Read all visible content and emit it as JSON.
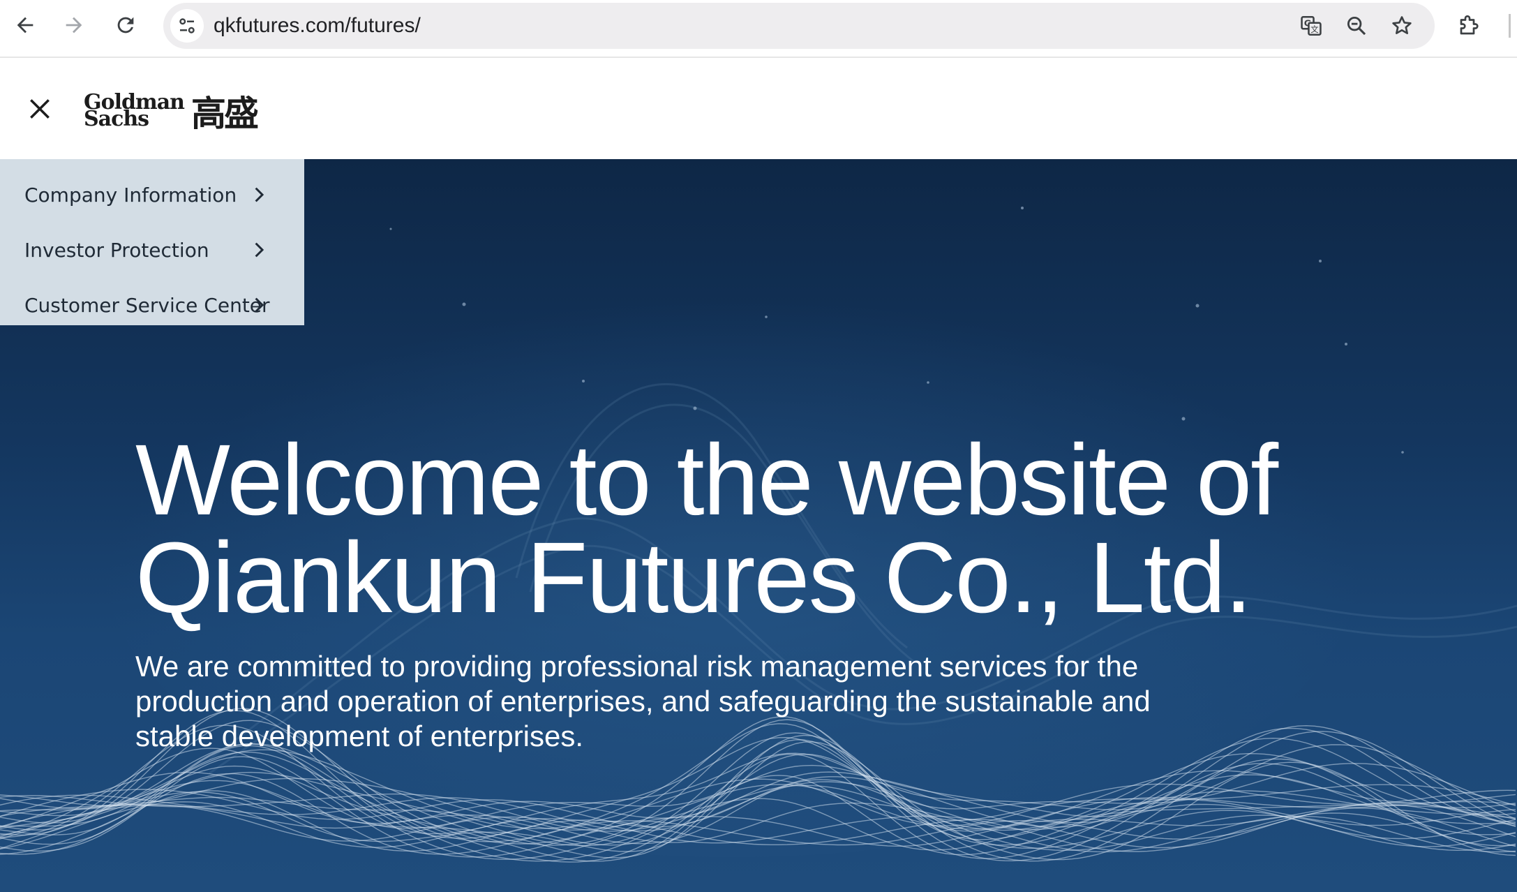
{
  "browser": {
    "url": "qkfutures.com/futures/",
    "back_icon": "arrow-left-icon",
    "forward_icon": "arrow-right-icon",
    "reload_icon": "reload-icon",
    "site_info_icon": "tune-icon",
    "translate_icon": "translate-icon",
    "zoom_icon": "zoom-out-icon",
    "bookmark_icon": "star-icon",
    "extensions_icon": "puzzle-icon"
  },
  "header": {
    "close_icon": "close-icon",
    "logo": {
      "line1": "Goldman",
      "line2": "Sachs",
      "chinese": "高盛"
    }
  },
  "menu": {
    "items": [
      {
        "label": "Company Information"
      },
      {
        "label": "Investor Protection"
      },
      {
        "label": "Customer Service Center"
      }
    ],
    "chevron_icon": "chevron-right-icon"
  },
  "hero": {
    "title_line1": "Welcome to the website of",
    "title_line2": "Qiankun Futures Co., Ltd.",
    "subtitle": "We are committed to providing professional risk management services for the production and operation of enterprises, and safeguarding the sustainable and stable development of enterprises."
  },
  "colors": {
    "hero_bg_top": "#0e2746",
    "hero_bg_bottom": "#1f4c7c",
    "menu_bg": "#d3dde5",
    "menu_text": "#1f2a36",
    "omnibox_bg": "#eeedef"
  }
}
